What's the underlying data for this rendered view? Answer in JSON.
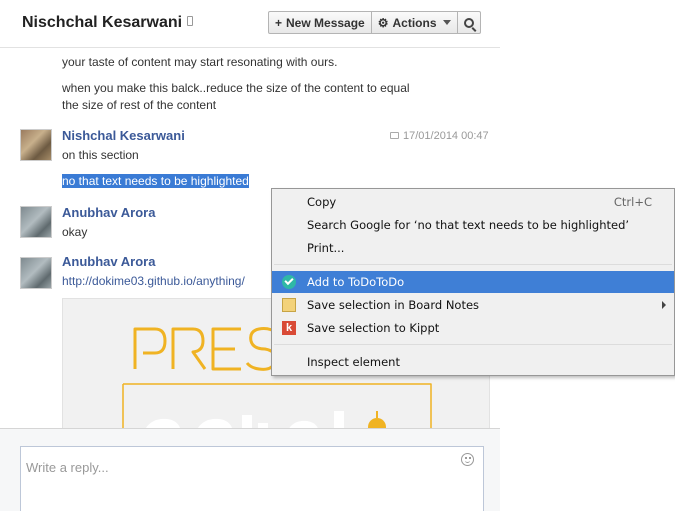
{
  "header": {
    "title": "Nischchal Kesarwani",
    "new_message_label": "New Message",
    "new_message_glyph": "+",
    "actions_label": "Actions",
    "actions_glyph": "⚙"
  },
  "messages": {
    "prev_line_1": "your taste of content may start resonating with ours.",
    "prev_line_2a": "when you make this balck..reduce the size of the content to equal",
    "prev_line_2b": "the size of rest of the content",
    "msg1": {
      "author": "Nishchal Kesarwani",
      "timestamp": "17/01/2014 00:47",
      "line1": "on this section",
      "line2": "no that text needs to be highlighted"
    },
    "msg2": {
      "author": "Anubhav Arora",
      "line1": "okay"
    },
    "msg3": {
      "author": "Anubhav Arora",
      "link": "http://dokime03.github.io/anything/"
    }
  },
  "reply": {
    "placeholder": "Write a reply..."
  },
  "context_menu": {
    "copy": "Copy",
    "copy_shortcut": "Ctrl+C",
    "search": "Search Google for ‘no that text needs to be highlighted’",
    "print": "Print...",
    "todo": "Add to ToDoToDo",
    "board_notes": "Save selection in Board Notes",
    "kippt": "Save selection to Kippt",
    "kippt_glyph": "k",
    "inspect": "Inspect element"
  },
  "colors": {
    "link": "#3b5998",
    "selection": "#3a7bd5",
    "menu_active": "#3f7fd6",
    "preview_logo": "#f0b323"
  }
}
